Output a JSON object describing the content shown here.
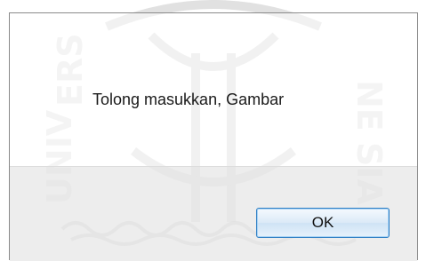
{
  "dialog": {
    "message": "Tolong masukkan, Gambar",
    "ok_label": "OK"
  },
  "colors": {
    "button_border": "#2f7fc4",
    "button_area_bg": "#e8e8e8",
    "watermark": "#9a9a9a"
  },
  "watermark": {
    "icon": "university-logo-watermark"
  }
}
